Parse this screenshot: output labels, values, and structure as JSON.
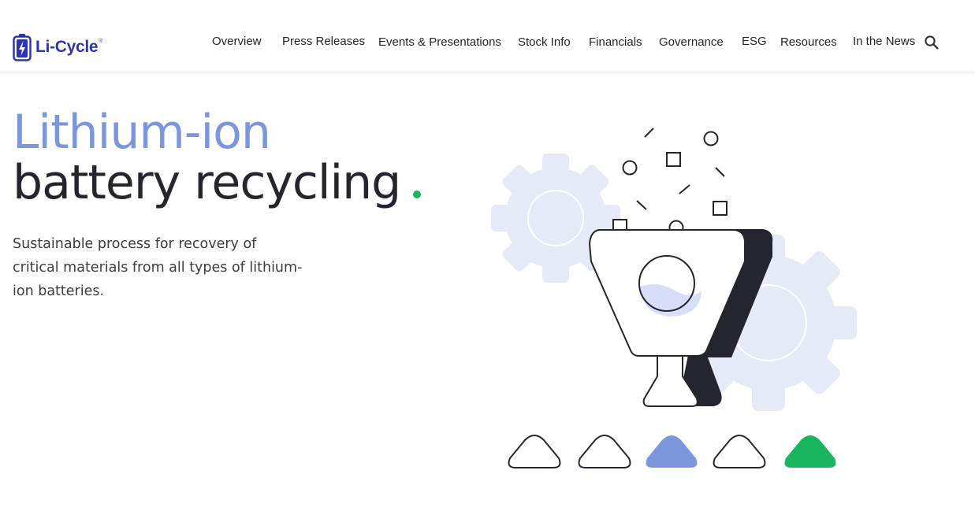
{
  "header": {
    "logo_text": "Li-Cycle",
    "logo_reg": "®",
    "nav_items": [
      "Overview",
      "Press Releases",
      "Events & Presentations",
      "Stock Info",
      "Financials",
      "Governance",
      "ESG",
      "Resources",
      "In the News"
    ]
  },
  "hero": {
    "title_line1": "Lithium-ion",
    "title_line2": "battery recycling",
    "subtitle": "Sustainable process for recovery of critical materials from all types of lithium-ion batteries."
  },
  "colors": {
    "brand_blue": "#2a35b5",
    "accent_periwinkle": "#7b96dc",
    "accent_green": "#19b45e",
    "dark": "#24252e",
    "gear": "#e5eaf6"
  },
  "icons": {
    "logo": "battery-bolt-icon",
    "search": "search-icon",
    "illustration": "battery-recycling-funnel-illustration"
  }
}
